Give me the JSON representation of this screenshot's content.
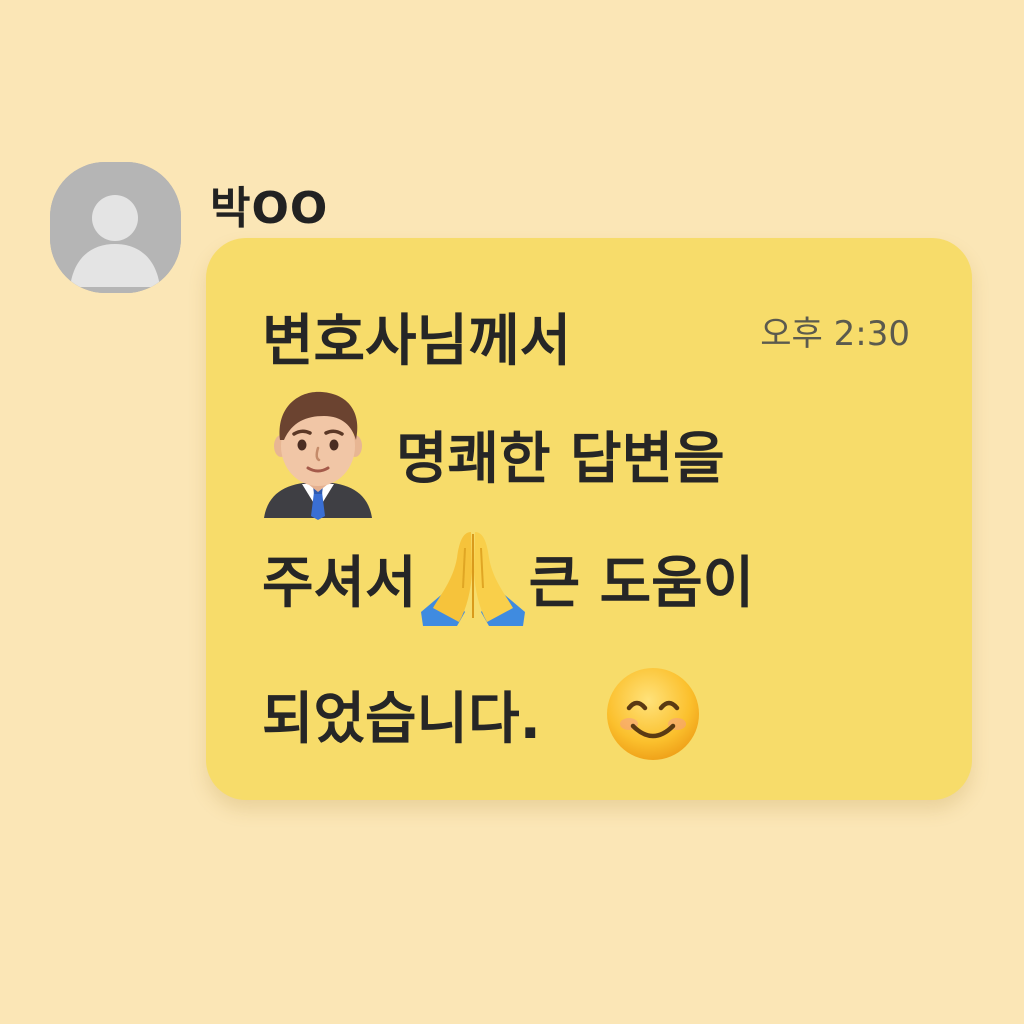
{
  "chat": {
    "sender_name": "박OO",
    "message": {
      "time": "오후 2:30",
      "line1": "변호사님께서",
      "line2_text": "명쾌한 답변을",
      "line3_text_a": "주셔서",
      "line3_text_b": "큰 도움이",
      "line4_text": "되었습니다."
    },
    "icons": {
      "avatar": "default-user-icon",
      "lawyer": "man-office-worker-emoji",
      "pray": "folded-hands-emoji",
      "smile": "smiling-face-emoji"
    }
  },
  "colors": {
    "background": "#fbe6b6",
    "bubble": "#f7dc6a",
    "text": "#262626",
    "time": "#5b5a4e",
    "avatar": "#b5b5b5"
  }
}
